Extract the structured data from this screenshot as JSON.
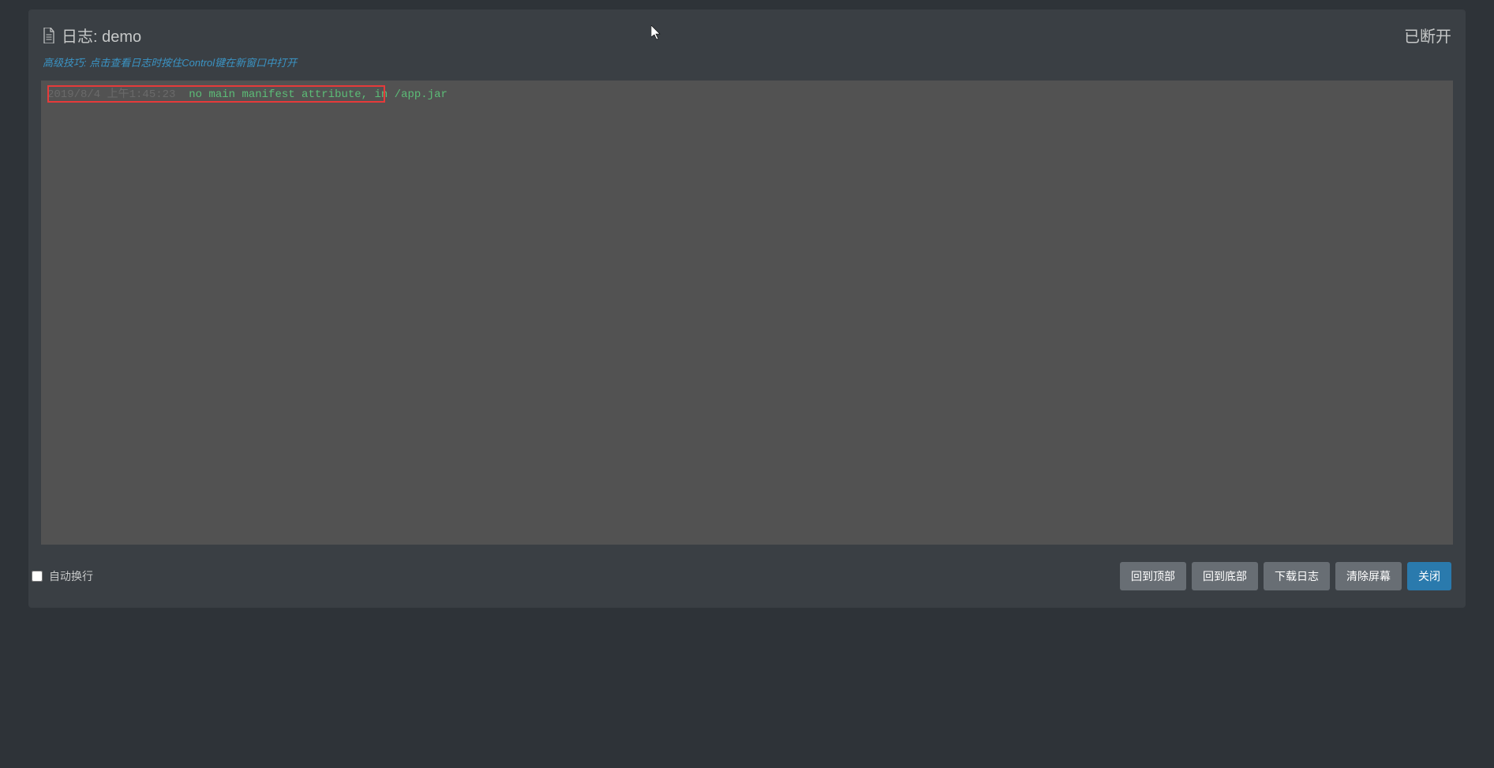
{
  "header": {
    "title_prefix": "日志:",
    "title_name": "demo",
    "status": "已断开"
  },
  "tip": {
    "prefix": "高级技巧:",
    "text": "点击查看日志时按住Control键在新窗口中打开"
  },
  "log": {
    "timestamp": "2019/8/4 上午1:45:23",
    "message": "no main manifest attribute, in /app.jar"
  },
  "footer": {
    "auto_wrap_label": "自动换行",
    "buttons": {
      "scroll_top": "回到顶部",
      "scroll_bottom": "回到底部",
      "download": "下载日志",
      "clear": "清除屏幕",
      "close": "关闭"
    }
  }
}
